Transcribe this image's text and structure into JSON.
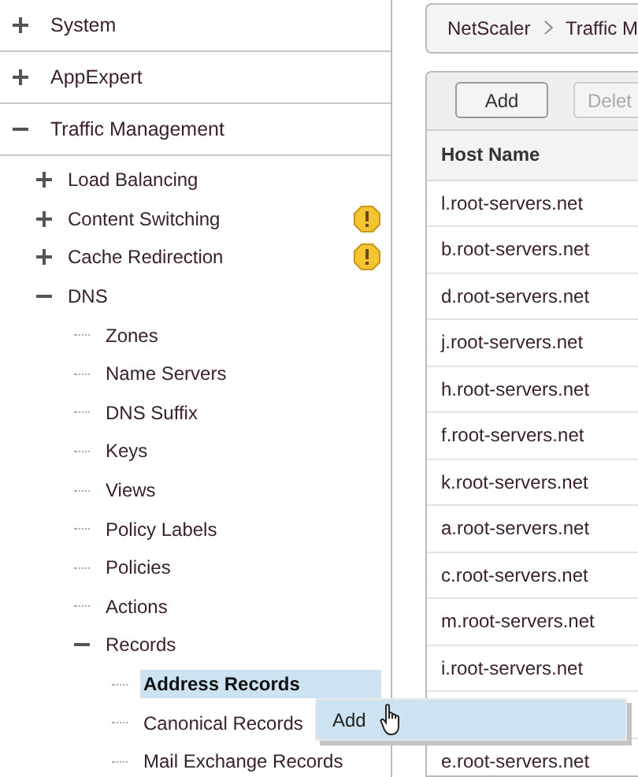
{
  "sections": [
    {
      "label": "System",
      "expanded": false
    },
    {
      "label": "AppExpert",
      "expanded": false
    },
    {
      "label": "Traffic Management",
      "expanded": true,
      "children": [
        {
          "label": "Load Balancing",
          "expanded": false,
          "warning": false,
          "selected": false
        },
        {
          "label": "Content Switching",
          "expanded": false,
          "warning": true,
          "selected": false
        },
        {
          "label": "Cache Redirection",
          "expanded": false,
          "warning": true,
          "selected": false
        },
        {
          "label": "DNS",
          "expanded": true,
          "warning": false,
          "selected": false,
          "children": [
            {
              "label": "Zones",
              "selected": false
            },
            {
              "label": "Name Servers",
              "selected": false
            },
            {
              "label": "DNS Suffix",
              "selected": false
            },
            {
              "label": "Keys",
              "selected": false
            },
            {
              "label": "Views",
              "selected": false
            },
            {
              "label": "Policy Labels",
              "selected": false
            },
            {
              "label": "Policies",
              "selected": false
            },
            {
              "label": "Actions",
              "selected": false
            },
            {
              "label": "Records",
              "expanded": true,
              "selected": false,
              "children": [
                {
                  "label": "Address Records",
                  "selected": true
                },
                {
                  "label": "Canonical Records",
                  "selected": false
                },
                {
                  "label": "Mail Exchange Records",
                  "selected": false
                }
              ]
            }
          ]
        }
      ]
    }
  ],
  "breadcrumb": [
    "NetScaler",
    "Traffic M"
  ],
  "toolbar": [
    {
      "label": "Add",
      "disabled": false
    },
    {
      "label": "Delet",
      "disabled": true
    }
  ],
  "table": {
    "columns": [
      "Host Name"
    ],
    "rows": [
      {
        "kind": "host",
        "host_name": "l.root-servers.net"
      },
      {
        "kind": "host",
        "host_name": "b.root-servers.net"
      },
      {
        "kind": "host",
        "host_name": "d.root-servers.net"
      },
      {
        "kind": "host",
        "host_name": "j.root-servers.net"
      },
      {
        "kind": "host",
        "host_name": "h.root-servers.net"
      },
      {
        "kind": "host",
        "host_name": "f.root-servers.net"
      },
      {
        "kind": "host",
        "host_name": "k.root-servers.net"
      },
      {
        "kind": "host",
        "host_name": "a.root-servers.net"
      },
      {
        "kind": "host",
        "host_name": "c.root-servers.net"
      },
      {
        "kind": "host",
        "host_name": "m.root-servers.net"
      },
      {
        "kind": "host",
        "host_name": "i.root-servers.net"
      },
      {
        "kind": "covered"
      },
      {
        "kind": "host",
        "host_name": "e.root-servers.net"
      }
    ]
  },
  "context_menu": {
    "items": [
      {
        "label": "Add"
      }
    ]
  }
}
